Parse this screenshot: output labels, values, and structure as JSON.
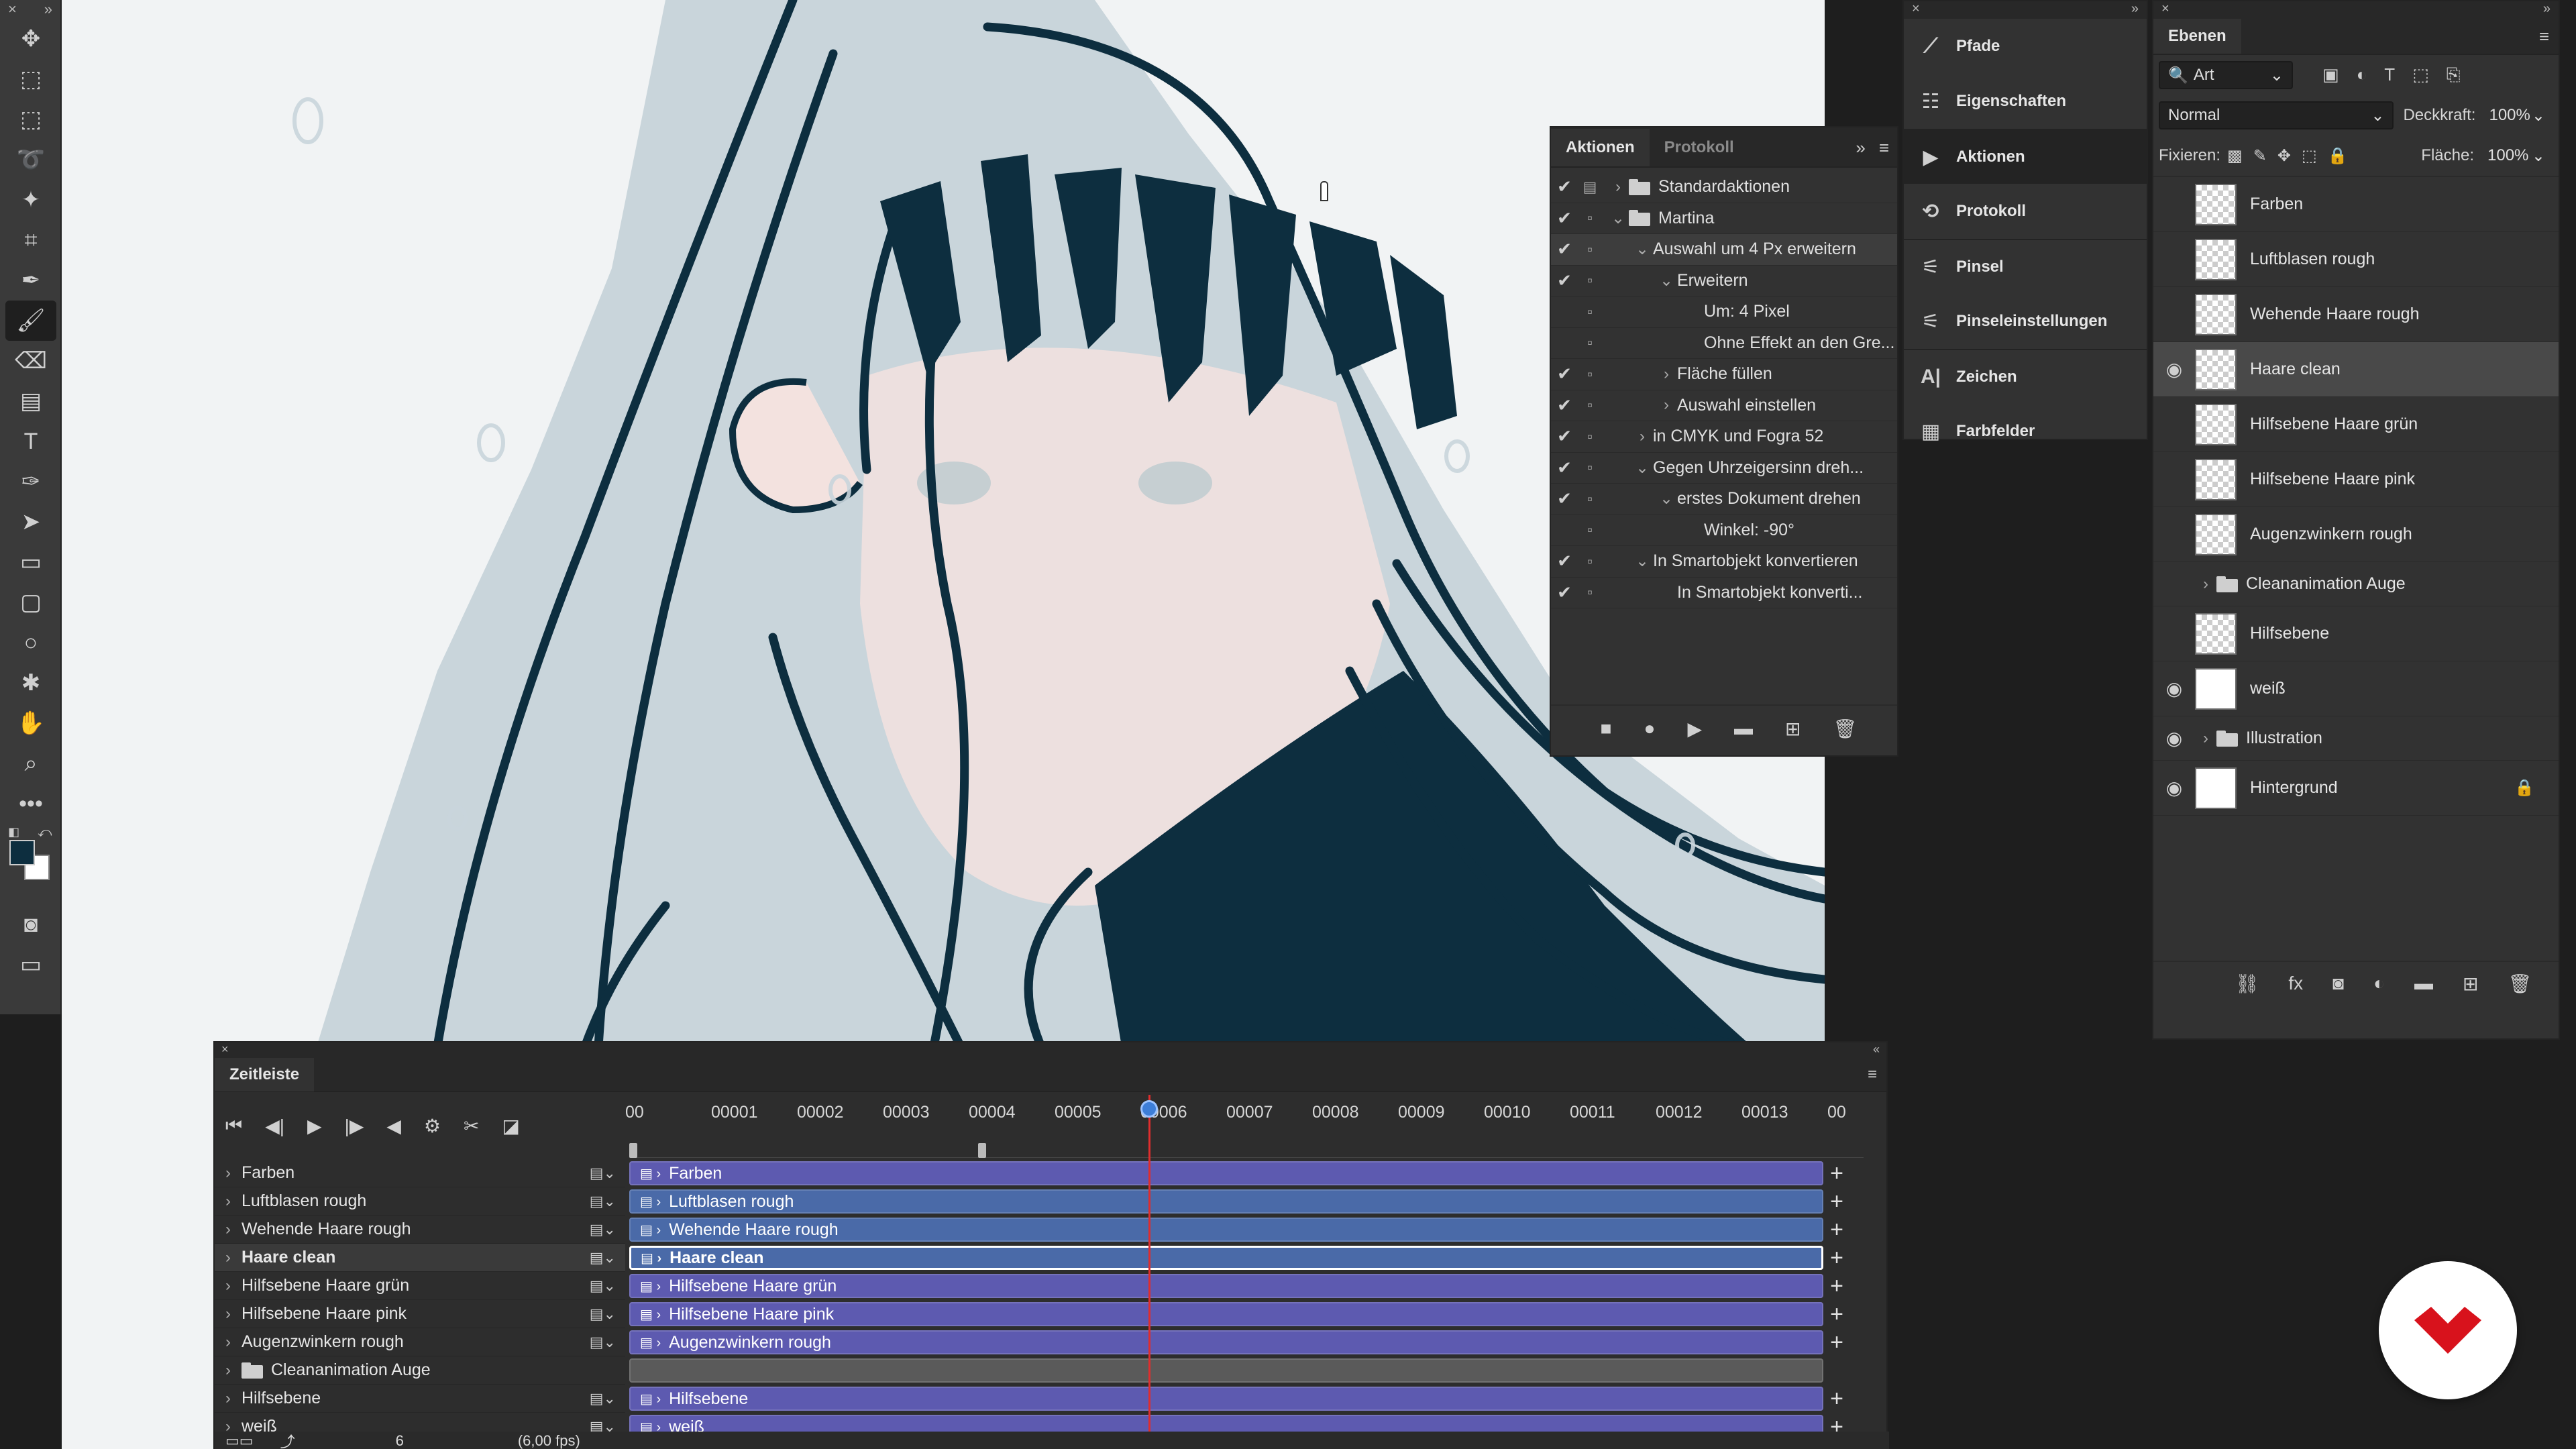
{
  "toolbar": {
    "tools": [
      "move-icon",
      "artboard-icon",
      "marquee-icon",
      "lasso-icon",
      "magic-wand-icon",
      "crop-icon",
      "eyedropper-icon",
      "brush-icon",
      "eraser-icon",
      "gradient-icon",
      "type-icon",
      "pen-icon",
      "path-select-icon",
      "rectangle-icon",
      "rounded-rect-icon",
      "ellipse-icon",
      "custom-shape-icon",
      "hand-icon",
      "zoom-icon",
      "more-icon"
    ],
    "active": "brush-icon",
    "colors": {
      "foreground": "#0d2e3f",
      "background": "#ffffff"
    }
  },
  "actions_panel": {
    "tabs": [
      "Aktionen",
      "Protokoll"
    ],
    "active_tab": "Aktionen",
    "rows": [
      {
        "indent": 0,
        "chev": "›",
        "folder": true,
        "label": "Standardaktionen",
        "checked": true,
        "dialog": true
      },
      {
        "indent": 0,
        "chev": "⌄",
        "folder": true,
        "label": "Martina",
        "checked": true,
        "dialog": false
      },
      {
        "indent": 1,
        "chev": "⌄",
        "folder": false,
        "label": "Auswahl um 4 Px erweitern",
        "checked": true,
        "dialog": false,
        "selected": true
      },
      {
        "indent": 2,
        "chev": "⌄",
        "folder": false,
        "label": "Erweitern",
        "checked": true,
        "dialog": false
      },
      {
        "indent": 3,
        "chev": "",
        "folder": false,
        "label": "Um: 4 Pixel",
        "checked": false,
        "dialog": false,
        "sub": true
      },
      {
        "indent": 3,
        "chev": "",
        "folder": false,
        "label": "Ohne Effekt an den Gre...",
        "checked": false,
        "dialog": false,
        "sub": true
      },
      {
        "indent": 2,
        "chev": "›",
        "folder": false,
        "label": "Fläche füllen",
        "checked": true,
        "dialog": false
      },
      {
        "indent": 2,
        "chev": "›",
        "folder": false,
        "label": "Auswahl einstellen",
        "checked": true,
        "dialog": false
      },
      {
        "indent": 1,
        "chev": "›",
        "folder": false,
        "label": "in CMYK und Fogra 52",
        "checked": true,
        "dialog": false
      },
      {
        "indent": 1,
        "chev": "⌄",
        "folder": false,
        "label": "Gegen Uhrzeigersinn dreh...",
        "checked": true,
        "dialog": false
      },
      {
        "indent": 2,
        "chev": "⌄",
        "folder": false,
        "label": "erstes Dokument drehen",
        "checked": true,
        "dialog": false
      },
      {
        "indent": 3,
        "chev": "",
        "folder": false,
        "label": "Winkel: -90°",
        "checked": false,
        "dialog": false,
        "sub": true
      },
      {
        "indent": 1,
        "chev": "⌄",
        "folder": false,
        "label": "In Smartobjekt konvertieren",
        "checked": true,
        "dialog": false
      },
      {
        "indent": 2,
        "chev": "",
        "folder": false,
        "label": "In Smartobjekt konverti...",
        "checked": true,
        "dialog": false
      }
    ]
  },
  "dock": {
    "items": [
      {
        "icon": "paths-icon",
        "glyph": "⟋",
        "label": "Pfade"
      },
      {
        "icon": "properties-icon",
        "glyph": "☷",
        "label": "Eigenschaften"
      },
      {
        "icon": "actions-icon",
        "glyph": "▶",
        "label": "Aktionen",
        "active": true
      },
      {
        "icon": "history-icon",
        "glyph": "⟲",
        "label": "Protokoll"
      },
      {
        "icon": "brush-icon",
        "glyph": "⚟",
        "label": "Pinsel"
      },
      {
        "icon": "brush-settings-icon",
        "glyph": "⚟",
        "label": "Pinseleinstellungen"
      },
      {
        "icon": "character-icon",
        "glyph": "A|",
        "label": "Zeichen"
      },
      {
        "icon": "swatches-icon",
        "glyph": "▦",
        "label": "Farbfelder"
      }
    ]
  },
  "layers_panel": {
    "title": "Ebenen",
    "filter": "Art",
    "blend_mode": "Normal",
    "opacity_label": "Deckkraft:",
    "opacity": "100%",
    "lock_label": "Fixieren:",
    "fill_label": "Fläche:",
    "fill": "100%",
    "layers": [
      {
        "name": "Farben",
        "visible": false,
        "thumb": "checker",
        "badge": true
      },
      {
        "name": "Luftblasen rough",
        "visible": false,
        "thumb": "checker",
        "badge": true
      },
      {
        "name": "Wehende Haare rough",
        "visible": false,
        "thumb": "checker",
        "badge": true
      },
      {
        "name": "Haare clean",
        "visible": true,
        "thumb": "checker",
        "badge": true,
        "selected": true
      },
      {
        "name": "Hilfsebene Haare grün",
        "visible": false,
        "thumb": "checker"
      },
      {
        "name": "Hilfsebene Haare pink",
        "visible": false,
        "thumb": "checker"
      },
      {
        "name": "Augenzwinkern rough",
        "visible": false,
        "thumb": "checker",
        "badge": true
      },
      {
        "name": "Cleananimation Auge",
        "visible": false,
        "group": true
      },
      {
        "name": "Hilfsebene",
        "visible": false,
        "thumb": "checker"
      },
      {
        "name": "weiß",
        "visible": true,
        "thumb": "white"
      },
      {
        "name": "Illustration",
        "visible": true,
        "group": true
      },
      {
        "name": "Hintergrund",
        "visible": true,
        "thumb": "white",
        "locked": true
      }
    ]
  },
  "timeline": {
    "title": "Zeitleiste",
    "frames": [
      "00",
      "00001",
      "00002",
      "00003",
      "00004",
      "00005",
      "00006",
      "00007",
      "00008",
      "00009",
      "00010",
      "00011",
      "00012",
      "00013",
      "00"
    ],
    "current_frame": "6",
    "fps": "(6,00 fps)",
    "tracks": [
      {
        "name": "Farben",
        "clip": "Farben",
        "color": "v",
        "bold": false
      },
      {
        "name": "Luftblasen rough",
        "clip": "Luftblasen rough",
        "color": "b"
      },
      {
        "name": "Wehende Haare rough",
        "clip": "Wehende Haare rough",
        "color": "b"
      },
      {
        "name": "Haare clean",
        "clip": "Haare clean",
        "color": "b",
        "bold": true
      },
      {
        "name": "Hilfsebene Haare grün",
        "clip": "Hilfsebene Haare grün",
        "color": "v"
      },
      {
        "name": "Hilfsebene Haare pink",
        "clip": "Hilfsebene Haare pink",
        "color": "v"
      },
      {
        "name": "Augenzwinkern rough",
        "clip": "Augenzwinkern rough",
        "color": "v"
      },
      {
        "name": "Cleananimation Auge",
        "clip": "",
        "color": "g",
        "group": true
      },
      {
        "name": "Hilfsebene",
        "clip": "Hilfsebene",
        "color": "v"
      },
      {
        "name": "weiß",
        "clip": "weiß",
        "color": "v"
      }
    ]
  }
}
